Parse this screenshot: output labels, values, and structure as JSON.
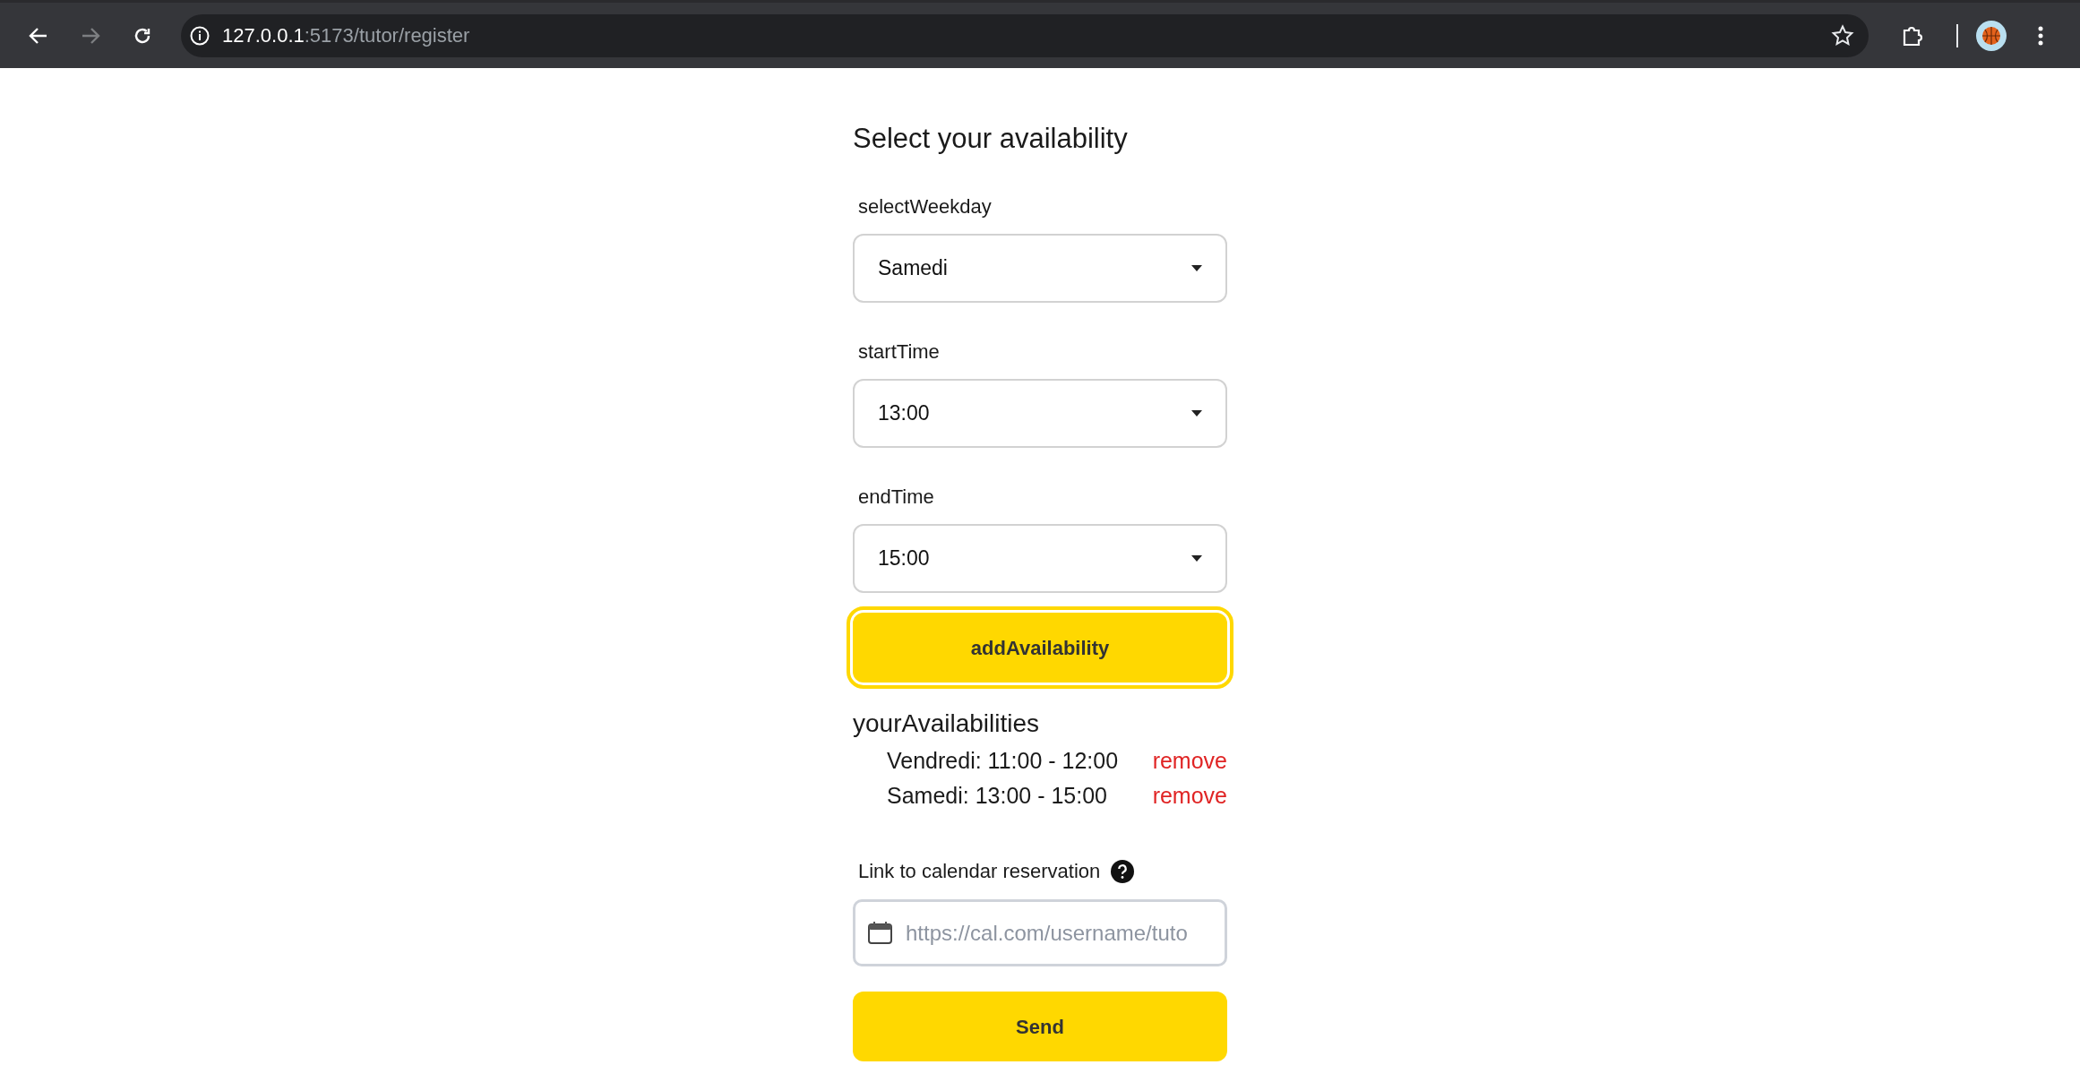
{
  "browser": {
    "url_host": "127.0.0.1",
    "url_path": ":5173/tutor/register",
    "back_disabled": false,
    "forward_disabled": true
  },
  "form": {
    "title": "Select your availability",
    "selects": [
      {
        "label": "selectWeekday",
        "value": "Samedi"
      },
      {
        "label": "startTime",
        "value": "13:00"
      },
      {
        "label": "endTime",
        "value": "15:00"
      }
    ],
    "add_button": {
      "label": "addAvailability",
      "focused": true
    },
    "availabilities_title": "yourAvailabilities",
    "availabilities": [
      {
        "text": "Vendredi: 11:00 - 12:00",
        "action": "remove"
      },
      {
        "text": "Samedi: 13:00 - 15:00",
        "action": "remove"
      }
    ],
    "calendar_link": {
      "label": "Link to calendar reservation",
      "placeholder": "https://cal.com/username/tuto"
    },
    "send_button": {
      "label": "Send"
    }
  }
}
